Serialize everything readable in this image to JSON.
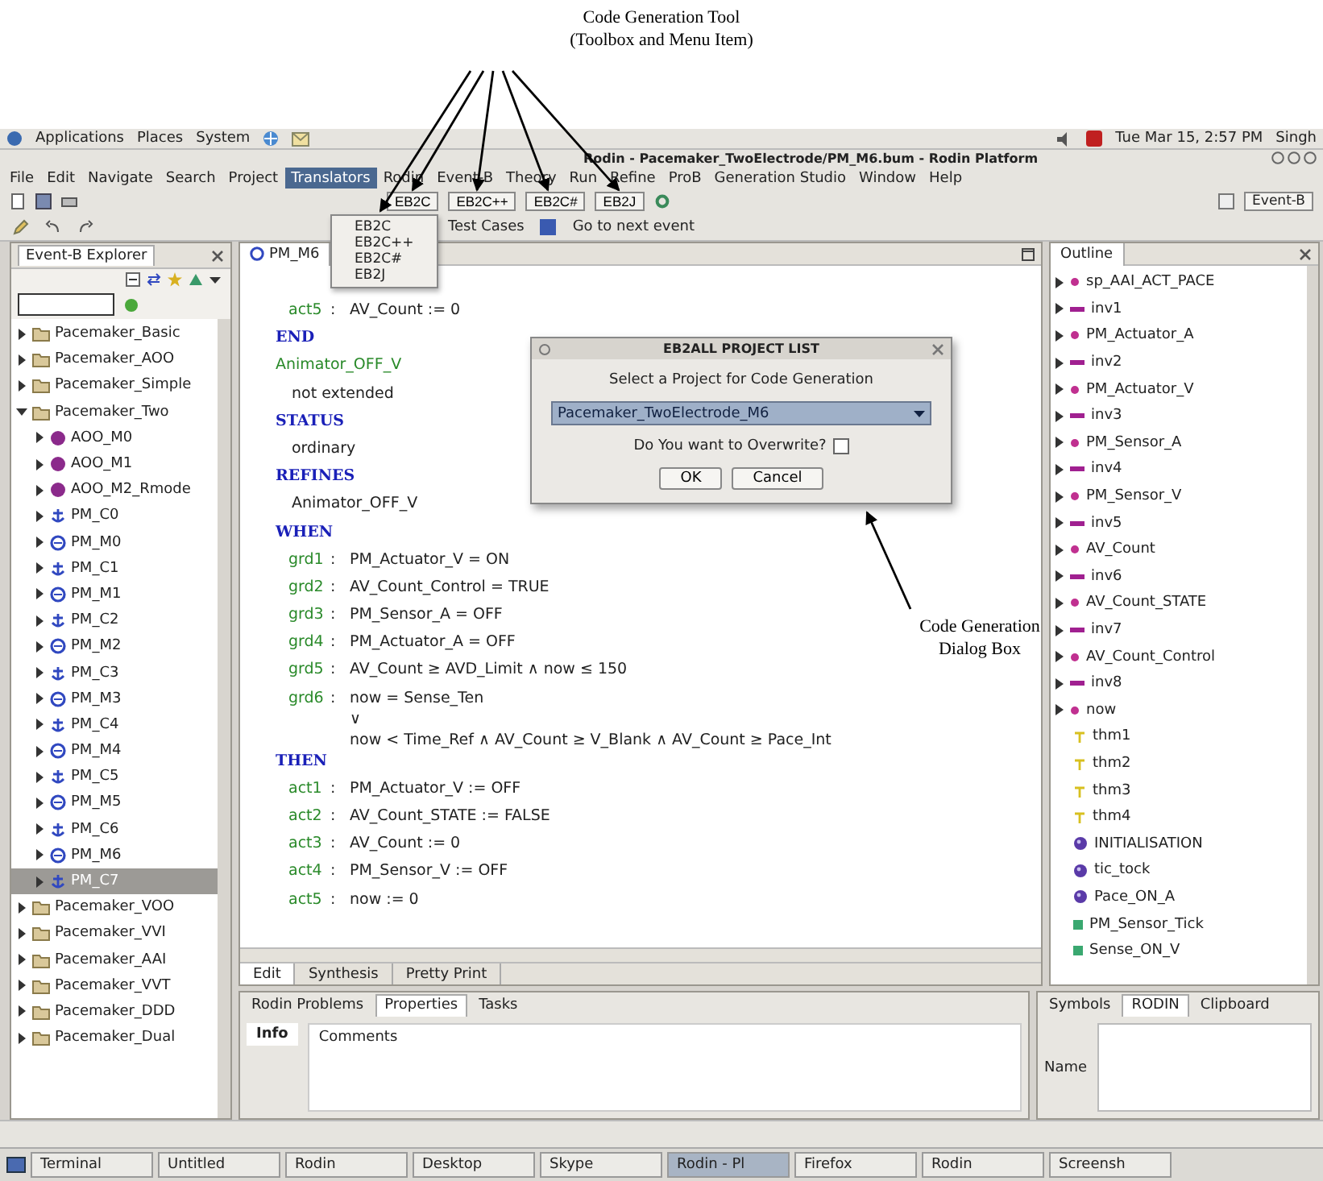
{
  "figure": {
    "tool_label": [
      "Code Generation Tool",
      "(Toolbox and Menu Item)"
    ],
    "dialog_label": [
      "Code Generation",
      "Dialog Box"
    ]
  },
  "system_bar": {
    "items": [
      "Applications",
      "Places",
      "System"
    ],
    "clock": "Tue Mar 15, 2:57 PM",
    "user": "Singh"
  },
  "window": {
    "title": "Rodin - Pacemaker_TwoElectrode/PM_M6.bum - Rodin Platform"
  },
  "menus": [
    {
      "label": "File",
      "selected": false
    },
    {
      "label": "Edit",
      "selected": false
    },
    {
      "label": "Navigate",
      "selected": false
    },
    {
      "label": "Search",
      "selected": false
    },
    {
      "label": "Project",
      "selected": false
    },
    {
      "label": "Translators",
      "selected": true
    },
    {
      "label": "Rodin",
      "selected": false
    },
    {
      "label": "Event-B",
      "selected": false
    },
    {
      "label": "Theory",
      "selected": false
    },
    {
      "label": "Run",
      "selected": false
    },
    {
      "label": "Refine",
      "selected": false
    },
    {
      "label": "ProB",
      "selected": false
    },
    {
      "label": "Generation Studio",
      "selected": false
    },
    {
      "label": "Window",
      "selected": false
    },
    {
      "label": "Help",
      "selected": false
    }
  ],
  "menu_dropdown": [
    "EB2C",
    "EB2C++",
    "EB2C#",
    "EB2J"
  ],
  "toolbar": {
    "buttons": [
      "EB2C",
      "EB2C++",
      "EB2C#",
      "EB2J"
    ],
    "perspective": "Event-B"
  },
  "toolbar2": {
    "items": [
      "Test Cases",
      "Go to next event"
    ]
  },
  "explorer": {
    "title": "Event-B Explorer",
    "items": [
      {
        "kind": "project",
        "label": "Pacemaker_Basic",
        "expanded": false,
        "selected": false
      },
      {
        "kind": "project",
        "label": "Pacemaker_AOO",
        "expanded": false,
        "selected": false
      },
      {
        "kind": "project",
        "label": "Pacemaker_Simple",
        "expanded": false,
        "selected": false
      },
      {
        "kind": "project",
        "label": "Pacemaker_Two",
        "expanded": true,
        "selected": false,
        "children": [
          {
            "kind": "ball",
            "label": "AOO_M0",
            "expanded": false,
            "selected": false
          },
          {
            "kind": "ball",
            "label": "AOO_M1",
            "expanded": false,
            "selected": false
          },
          {
            "kind": "ball",
            "label": "AOO_M2_Rmode",
            "expanded": false,
            "selected": false
          },
          {
            "kind": "context",
            "label": "PM_C0",
            "expanded": false,
            "selected": false
          },
          {
            "kind": "machine",
            "label": "PM_M0",
            "expanded": false,
            "selected": false
          },
          {
            "kind": "context",
            "label": "PM_C1",
            "expanded": false,
            "selected": false
          },
          {
            "kind": "machine",
            "label": "PM_M1",
            "expanded": false,
            "selected": false
          },
          {
            "kind": "context",
            "label": "PM_C2",
            "expanded": false,
            "selected": false
          },
          {
            "kind": "machine",
            "label": "PM_M2",
            "expanded": false,
            "selected": false
          },
          {
            "kind": "context",
            "label": "PM_C3",
            "expanded": false,
            "selected": false
          },
          {
            "kind": "machine",
            "label": "PM_M3",
            "expanded": false,
            "selected": false
          },
          {
            "kind": "context",
            "label": "PM_C4",
            "expanded": false,
            "selected": false
          },
          {
            "kind": "machine",
            "label": "PM_M4",
            "expanded": false,
            "selected": false
          },
          {
            "kind": "context",
            "label": "PM_C5",
            "expanded": false,
            "selected": false
          },
          {
            "kind": "machine",
            "label": "PM_M5",
            "expanded": false,
            "selected": false
          },
          {
            "kind": "context",
            "label": "PM_C6",
            "expanded": false,
            "selected": false
          },
          {
            "kind": "machine",
            "label": "PM_M6",
            "expanded": false,
            "selected": false
          },
          {
            "kind": "context",
            "label": "PM_C7",
            "expanded": false,
            "selected": true
          }
        ]
      },
      {
        "kind": "project",
        "label": "Pacemaker_VOO",
        "expanded": false,
        "selected": false
      },
      {
        "kind": "project",
        "label": "Pacemaker_VVI",
        "expanded": false,
        "selected": false
      },
      {
        "kind": "project",
        "label": "Pacemaker_AAI",
        "expanded": false,
        "selected": false
      },
      {
        "kind": "project",
        "label": "Pacemaker_VVT",
        "expanded": false,
        "selected": false
      },
      {
        "kind": "project",
        "label": "Pacemaker_DDD",
        "expanded": false,
        "selected": false
      },
      {
        "kind": "project",
        "label": "Pacemaker_Dual",
        "expanded": false,
        "selected": false
      }
    ]
  },
  "editor": {
    "tab": "PM_M6",
    "label_separator": ":",
    "lines": [
      {
        "kind": "labeled",
        "label": "act5",
        "text": [
          "AV_Count := 0"
        ]
      },
      {
        "kind": "keyword",
        "text": [
          "END"
        ]
      },
      {
        "kind": "name",
        "text": [
          "Animator_OFF_V"
        ]
      },
      {
        "kind": "plain",
        "text": [
          "not extended"
        ]
      },
      {
        "kind": "keyword",
        "text": [
          "STATUS"
        ]
      },
      {
        "kind": "plain",
        "text": [
          "ordinary"
        ]
      },
      {
        "kind": "keyword",
        "text": [
          "REFINES"
        ]
      },
      {
        "kind": "plain",
        "text": [
          "Animator_OFF_V"
        ]
      },
      {
        "kind": "keyword",
        "text": [
          "WHEN"
        ]
      },
      {
        "kind": "labeled",
        "label": "grd1",
        "text": [
          "PM_Actuator_V = ON"
        ]
      },
      {
        "kind": "labeled",
        "label": "grd2",
        "text": [
          "AV_Count_Control = TRUE"
        ]
      },
      {
        "kind": "labeled",
        "label": "grd3",
        "text": [
          "PM_Sensor_A = OFF"
        ]
      },
      {
        "kind": "labeled",
        "label": "grd4",
        "text": [
          "PM_Actuator_A = OFF"
        ]
      },
      {
        "kind": "labeled",
        "label": "grd5",
        "text": [
          "AV_Count ≥ AVD_Limit ∧ now ≤ 150"
        ]
      },
      {
        "kind": "labeled",
        "label": "grd6",
        "text": [
          "now = Sense_Ten",
          "∨",
          "now < Time_Ref ∧ AV_Count ≥ V_Blank ∧ AV_Count ≥ Pace_Int"
        ]
      },
      {
        "kind": "keyword",
        "text": [
          "THEN"
        ]
      },
      {
        "kind": "labeled",
        "label": "act1",
        "text": [
          "PM_Actuator_V := OFF"
        ]
      },
      {
        "kind": "labeled",
        "label": "act2",
        "text": [
          "AV_Count_STATE := FALSE"
        ]
      },
      {
        "kind": "labeled",
        "label": "act3",
        "text": [
          "AV_Count := 0"
        ]
      },
      {
        "kind": "labeled",
        "label": "act4",
        "text": [
          "PM_Sensor_V := OFF"
        ]
      },
      {
        "kind": "labeled",
        "label": "act5",
        "text": [
          "now := 0"
        ]
      }
    ],
    "bottom_tabs": [
      {
        "label": "Edit",
        "selected": true
      },
      {
        "label": "Synthesis",
        "selected": false
      },
      {
        "label": "Pretty Print",
        "selected": false
      }
    ]
  },
  "dialog": {
    "title": "EB2ALL PROJECT LIST",
    "prompt": "Select a Project for Code Generation",
    "project": "Pacemaker_TwoElectrode_M6",
    "checkbox": {
      "label": "Do You want to Overwrite?",
      "checked": false
    },
    "buttons": [
      "OK",
      "Cancel"
    ]
  },
  "outline": {
    "title": "Outline",
    "items": [
      {
        "kind": "variable",
        "label": "sp_AAI_ACT_PACE"
      },
      {
        "kind": "invariant",
        "label": "inv1"
      },
      {
        "kind": "variable",
        "label": "PM_Actuator_A"
      },
      {
        "kind": "invariant",
        "label": "inv2"
      },
      {
        "kind": "variable",
        "label": "PM_Actuator_V"
      },
      {
        "kind": "invariant",
        "label": "inv3"
      },
      {
        "kind": "variable",
        "label": "PM_Sensor_A"
      },
      {
        "kind": "invariant",
        "label": "inv4"
      },
      {
        "kind": "variable",
        "label": "PM_Sensor_V"
      },
      {
        "kind": "invariant",
        "label": "inv5"
      },
      {
        "kind": "variable",
        "label": "AV_Count"
      },
      {
        "kind": "invariant",
        "label": "inv6"
      },
      {
        "kind": "variable",
        "label": "AV_Count_STATE"
      },
      {
        "kind": "invariant",
        "label": "inv7"
      },
      {
        "kind": "variable",
        "label": "AV_Count_Control"
      },
      {
        "kind": "invariant",
        "label": "inv8"
      },
      {
        "kind": "variable",
        "label": "now"
      },
      {
        "kind": "theorem",
        "label": "thm1"
      },
      {
        "kind": "theorem",
        "label": "thm2"
      },
      {
        "kind": "theorem",
        "label": "thm3"
      },
      {
        "kind": "theorem",
        "label": "thm4"
      },
      {
        "kind": "event",
        "label": "INITIALISATION"
      },
      {
        "kind": "event",
        "label": "tic_tock"
      },
      {
        "kind": "event",
        "label": "Pace_ON_A"
      },
      {
        "kind": "new_event",
        "label": "PM_Sensor_Tick"
      },
      {
        "kind": "new_event",
        "label": "Sense_ON_V"
      }
    ]
  },
  "problems": {
    "tabs": [
      {
        "label": "Rodin Problems",
        "selected": false
      },
      {
        "label": "Properties",
        "selected": true
      },
      {
        "label": "Tasks",
        "selected": false
      }
    ],
    "section": "Info",
    "field_label": "Comments"
  },
  "symbols": {
    "tabs": [
      {
        "label": "Symbols",
        "selected": false
      },
      {
        "label": "RODIN",
        "selected": true
      },
      {
        "label": "Clipboard",
        "selected": false
      }
    ],
    "field_label": "Name"
  },
  "taskbar": {
    "items": [
      {
        "label": "Terminal",
        "selected": false
      },
      {
        "label": "Untitled",
        "selected": false
      },
      {
        "label": "Rodin",
        "selected": false
      },
      {
        "label": "Desktop",
        "selected": false
      },
      {
        "label": "Skype",
        "selected": false
      },
      {
        "label": "Rodin - Pl",
        "selected": true
      },
      {
        "label": "Firefox",
        "selected": false
      },
      {
        "label": "Rodin",
        "selected": false
      },
      {
        "label": "Screensh",
        "selected": false
      }
    ]
  }
}
